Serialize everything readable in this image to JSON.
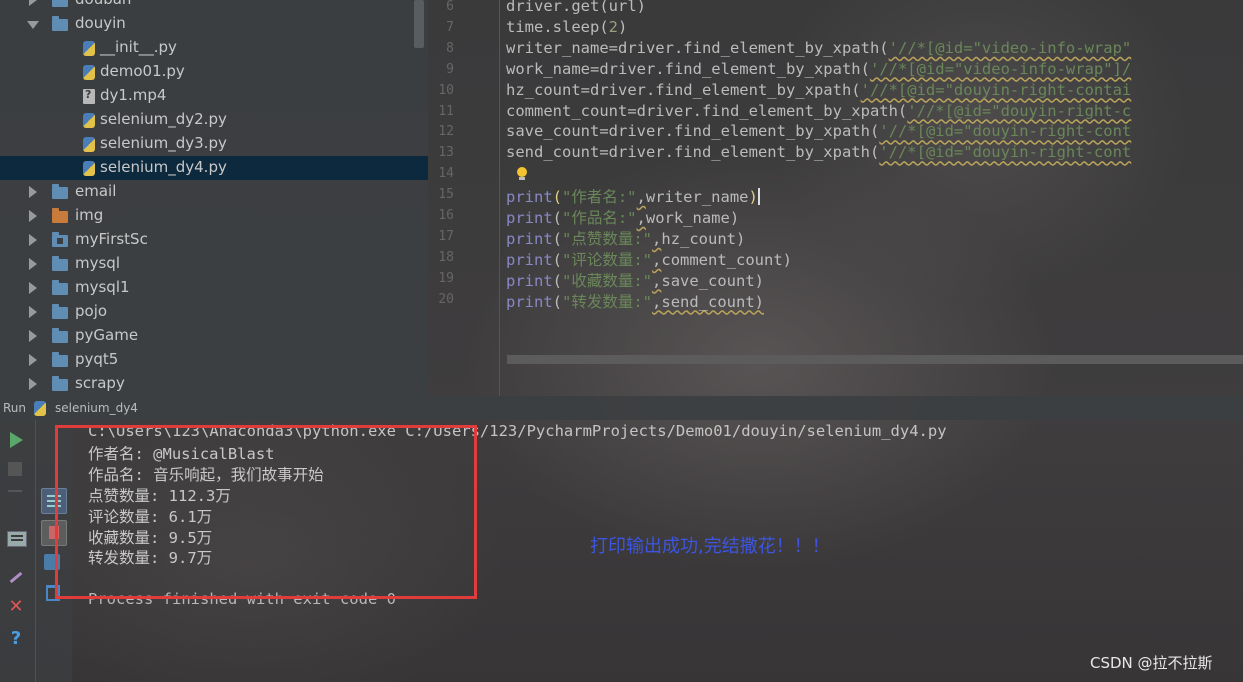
{
  "project_tree": {
    "rows": [
      {
        "label": "douban",
        "type": "folder",
        "expanded": false,
        "indent": 0
      },
      {
        "label": "douyin",
        "type": "folder",
        "expanded": true,
        "indent": 0
      },
      {
        "label": "__init__.py",
        "type": "py",
        "indent": 1
      },
      {
        "label": "demo01.py",
        "type": "py",
        "indent": 1
      },
      {
        "label": "dy1.mp4",
        "type": "unknown",
        "indent": 1
      },
      {
        "label": "selenium_dy2.py",
        "type": "py",
        "indent": 1
      },
      {
        "label": "selenium_dy3.py",
        "type": "py",
        "indent": 1
      },
      {
        "label": "selenium_dy4.py",
        "type": "py",
        "indent": 1,
        "selected": true
      },
      {
        "label": "email",
        "type": "folder",
        "expanded": false,
        "indent": 0
      },
      {
        "label": "img",
        "type": "folder-orange",
        "expanded": false,
        "indent": 0
      },
      {
        "label": "myFirstSc",
        "type": "folder-pkg",
        "expanded": false,
        "indent": 0
      },
      {
        "label": "mysql",
        "type": "folder",
        "expanded": false,
        "indent": 0
      },
      {
        "label": "mysql1",
        "type": "folder",
        "expanded": false,
        "indent": 0
      },
      {
        "label": "pojo",
        "type": "folder",
        "expanded": false,
        "indent": 0
      },
      {
        "label": "pyGame",
        "type": "folder",
        "expanded": false,
        "indent": 0
      },
      {
        "label": "pyqt5",
        "type": "folder",
        "expanded": false,
        "indent": 0
      },
      {
        "label": "scrapy",
        "type": "folder",
        "expanded": false,
        "indent": 0
      }
    ]
  },
  "editor": {
    "lines": [
      {
        "num": "6",
        "parts": [
          {
            "t": "driver.get(url)",
            "c": ""
          }
        ]
      },
      {
        "num": "7",
        "parts": [
          {
            "t": "time.sleep(",
            "c": ""
          },
          {
            "t": "2",
            "c": "cn"
          },
          {
            "t": ")",
            "c": ""
          }
        ]
      },
      {
        "num": "8",
        "parts": [
          {
            "t": "writer_name=driver.find_element_by_xpath(",
            "c": ""
          },
          {
            "t": "'//*[@id=\"video-info-wrap\"",
            "c": "str squig"
          }
        ]
      },
      {
        "num": "9",
        "parts": [
          {
            "t": "work_name=driver.find_element_by_xpath(",
            "c": ""
          },
          {
            "t": "'//*[@id=\"video-info-wrap\"]/",
            "c": "str squig"
          }
        ]
      },
      {
        "num": "10",
        "parts": [
          {
            "t": "hz_count=driver.find_element_by_xpath(",
            "c": ""
          },
          {
            "t": "'//*[@id=\"douyin-right-contai",
            "c": "str squig"
          }
        ]
      },
      {
        "num": "11",
        "parts": [
          {
            "t": "comment_count=driver.find_element_by_xpath(",
            "c": ""
          },
          {
            "t": "'//*[@id=\"douyin-right-c",
            "c": "str squig"
          }
        ]
      },
      {
        "num": "12",
        "parts": [
          {
            "t": "save_count=driver.find_element_by_xpath(",
            "c": ""
          },
          {
            "t": "'//*[@id=\"douyin-right-cont",
            "c": "str squig"
          }
        ]
      },
      {
        "num": "13",
        "parts": [
          {
            "t": "send_count=driver.find_element_by_xpath(",
            "c": ""
          },
          {
            "t": "'//*[@id=\"douyin-right-cont",
            "c": "str squig"
          }
        ]
      },
      {
        "num": "14",
        "parts": []
      },
      {
        "num": "15",
        "parts": [
          {
            "t": "print",
            "c": "kw"
          },
          {
            "t": "(",
            "c": "paren"
          },
          {
            "t": "\"作者名:\"",
            "c": "str"
          },
          {
            "t": ",",
            "c": "squig"
          },
          {
            "t": "writer_name",
            "c": ""
          },
          {
            "t": ")",
            "c": "paren"
          },
          {
            "t": "",
            "c": "caret"
          }
        ]
      },
      {
        "num": "16",
        "parts": [
          {
            "t": "print",
            "c": "kw"
          },
          {
            "t": "(",
            "c": ""
          },
          {
            "t": "\"作品名:\"",
            "c": "str"
          },
          {
            "t": ",",
            "c": "squig"
          },
          {
            "t": "work_name)",
            "c": ""
          }
        ]
      },
      {
        "num": "17",
        "parts": [
          {
            "t": "print",
            "c": "kw"
          },
          {
            "t": "(",
            "c": ""
          },
          {
            "t": "\"点赞数量:\"",
            "c": "str"
          },
          {
            "t": ",",
            "c": "squig"
          },
          {
            "t": "hz_count)",
            "c": ""
          }
        ]
      },
      {
        "num": "18",
        "parts": [
          {
            "t": "print",
            "c": "kw"
          },
          {
            "t": "(",
            "c": ""
          },
          {
            "t": "\"评论数量:\"",
            "c": "str"
          },
          {
            "t": ",",
            "c": "squig"
          },
          {
            "t": "comment_count)",
            "c": ""
          }
        ]
      },
      {
        "num": "19",
        "parts": [
          {
            "t": "print",
            "c": "kw"
          },
          {
            "t": "(",
            "c": ""
          },
          {
            "t": "\"收藏数量:\"",
            "c": "str"
          },
          {
            "t": ",",
            "c": "squig"
          },
          {
            "t": "save_count)",
            "c": ""
          }
        ]
      },
      {
        "num": "20",
        "parts": [
          {
            "t": "print",
            "c": "kw"
          },
          {
            "t": "(",
            "c": ""
          },
          {
            "t": "\"转发数量:\"",
            "c": "str"
          },
          {
            "t": ",",
            "c": "squig"
          },
          {
            "t": "send_count)",
            "c": "squig"
          }
        ]
      }
    ]
  },
  "run_window": {
    "run_label": "Run",
    "tab_name": "selenium_dy4",
    "command": "C:\\Users\\123\\Anaconda3\\python.exe C:/Users/123/PycharmProjects/Demo01/douyin/selenium_dy4.py",
    "output": [
      "作者名: @MusicalBlast",
      "作品名: 音乐响起，我们故事开始",
      "点赞数量: 112.3万",
      "评论数量: 6.1万",
      "收藏数量: 9.5万",
      "转发数量: 9.7万"
    ],
    "exit_message": "Process finished with exit code 0"
  },
  "annotation_text": "打印输出成功,完结撒花！！！",
  "watermark": "CSDN @拉不拉斯",
  "colors": {
    "highlight_box": "#e03c3c",
    "annotation": "#3d55e0",
    "keyword": "#8888c6",
    "string": "#6a8759"
  }
}
